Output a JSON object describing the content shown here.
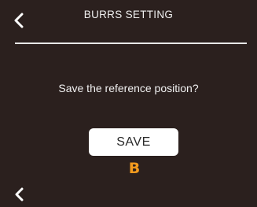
{
  "header": {
    "title": "BURRS SETTING",
    "back_icon": "chevron-left-icon"
  },
  "dialog": {
    "question": "Save the reference position?",
    "save_label": "SAVE"
  },
  "badge": {
    "text": "B",
    "color": "#f39a1e"
  },
  "footer": {
    "back_icon": "chevron-left-icon"
  },
  "colors": {
    "background": "#2b201e",
    "text": "#f0f0f0",
    "button": "#ffffff"
  }
}
